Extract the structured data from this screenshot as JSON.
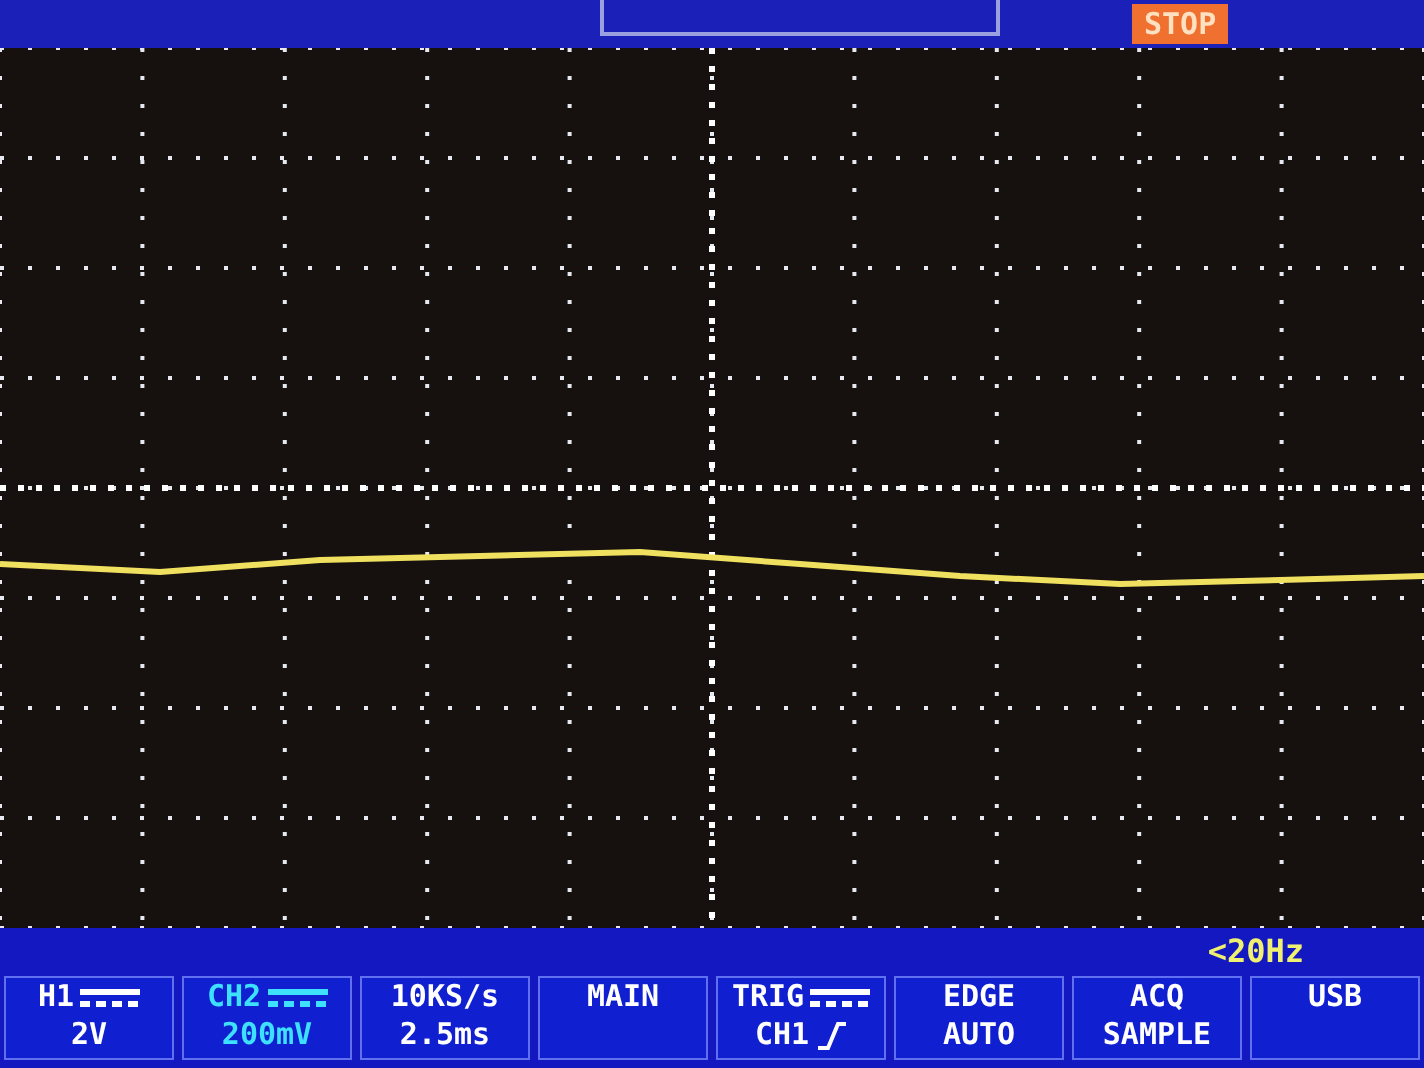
{
  "top_bar": {
    "run_state": "STOP"
  },
  "frequency": "<20Hz",
  "softkeys": [
    {
      "kind": "channel",
      "line1": "H1",
      "line2": "2V",
      "color": "#ffffff"
    },
    {
      "kind": "channel",
      "line1": "CH2",
      "line2": "200mV",
      "color": "#3ee0ff"
    },
    {
      "kind": "plain",
      "line1": "10KS/s",
      "line2": "2.5ms",
      "color": "#ffffff"
    },
    {
      "kind": "plain",
      "line1": "MAIN",
      "color": "#ffffff"
    },
    {
      "kind": "trigger",
      "line1": "TRIG",
      "line2": "CH1",
      "color": "#ffffff"
    },
    {
      "kind": "plain",
      "line1": "EDGE",
      "line2": "AUTO",
      "color": "#ffffff"
    },
    {
      "kind": "plain",
      "line1": "ACQ",
      "line2": "SAMPLE",
      "color": "#ffffff"
    },
    {
      "kind": "plain",
      "line1": "USB",
      "color": "#ffffff"
    }
  ]
}
